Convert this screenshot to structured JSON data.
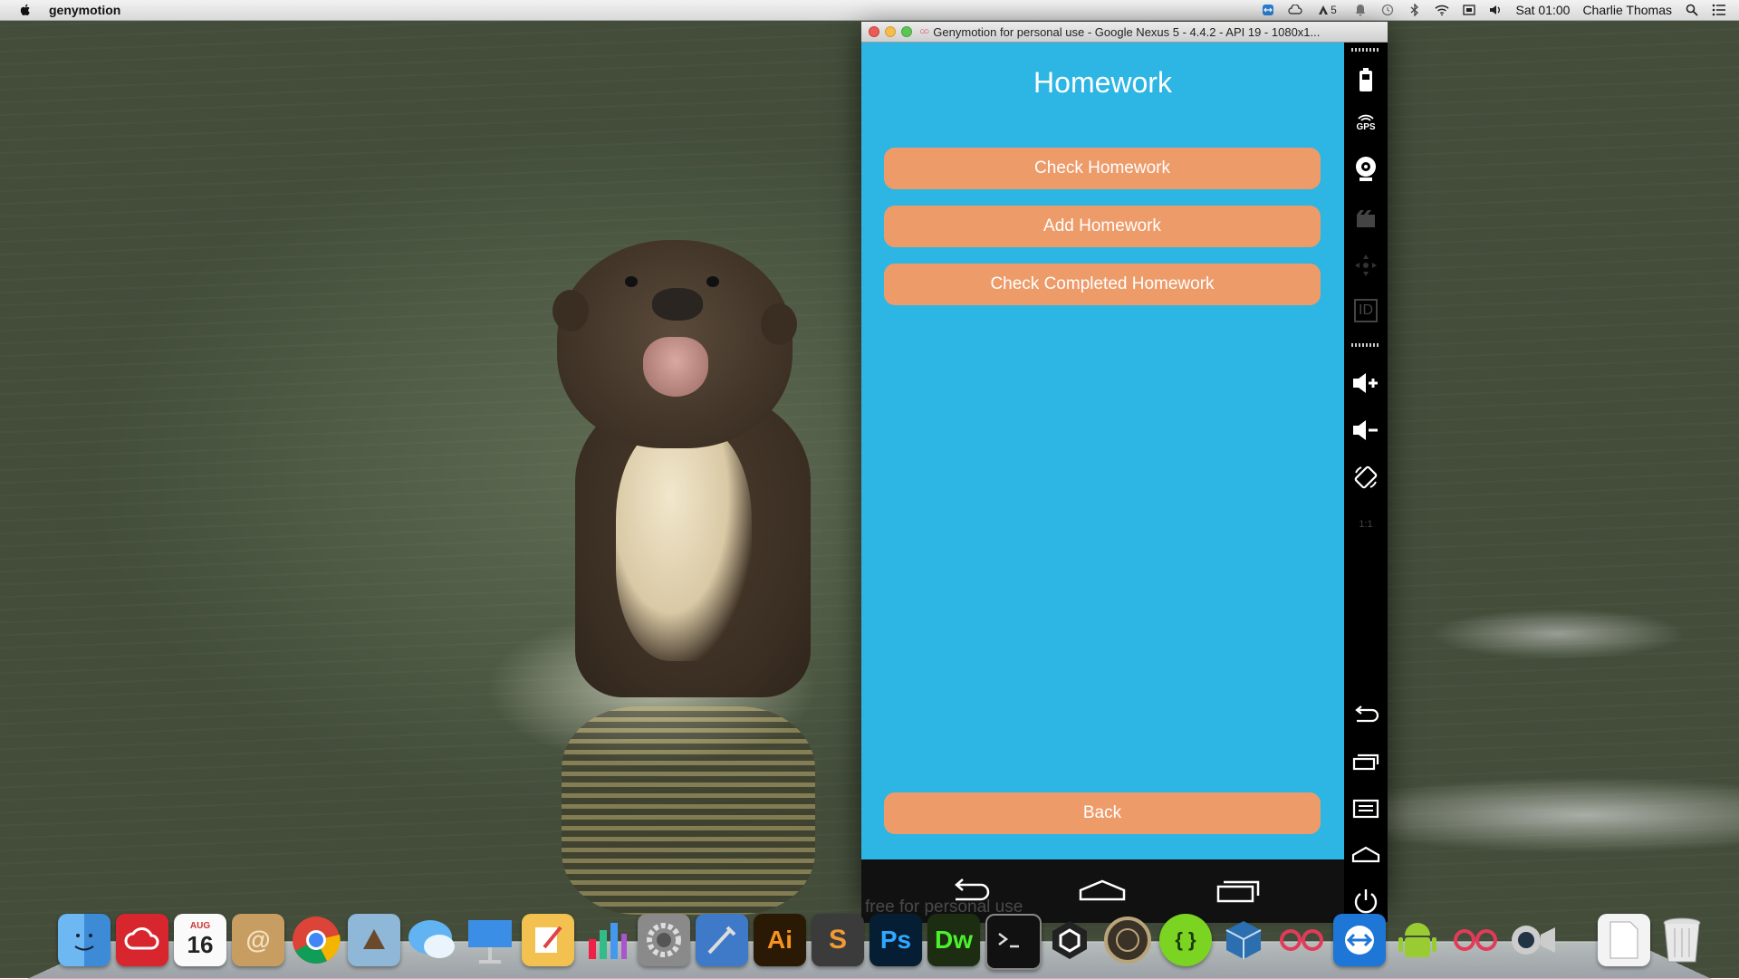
{
  "menubar": {
    "app_name": "genymotion",
    "status_text": "5",
    "clock": "Sat 01:00",
    "user": "Charlie Thomas"
  },
  "window": {
    "title": "Genymotion for personal use - Google Nexus 5 - 4.4.2 - API 19 - 1080x1..."
  },
  "app": {
    "title": "Homework",
    "buttons": {
      "check": "Check Homework",
      "add": "Add Homework",
      "completed": "Check Completed Homework",
      "back": "Back"
    }
  },
  "navbar": {
    "watermark": "free for personal use"
  },
  "toolbar": {
    "gps_label": "GPS",
    "id_label": "ID",
    "scale_label": "1:1"
  },
  "dock": {
    "calendar_month": "AUG",
    "calendar_day": "16",
    "ai_label": "Ai",
    "ps_label": "Ps",
    "dw_label": "Dw",
    "brackets_label": "{ }"
  },
  "colors": {
    "screen_bg": "#2db5e3",
    "button_bg": "#ee9b6a",
    "button_text": "#ffffff"
  }
}
